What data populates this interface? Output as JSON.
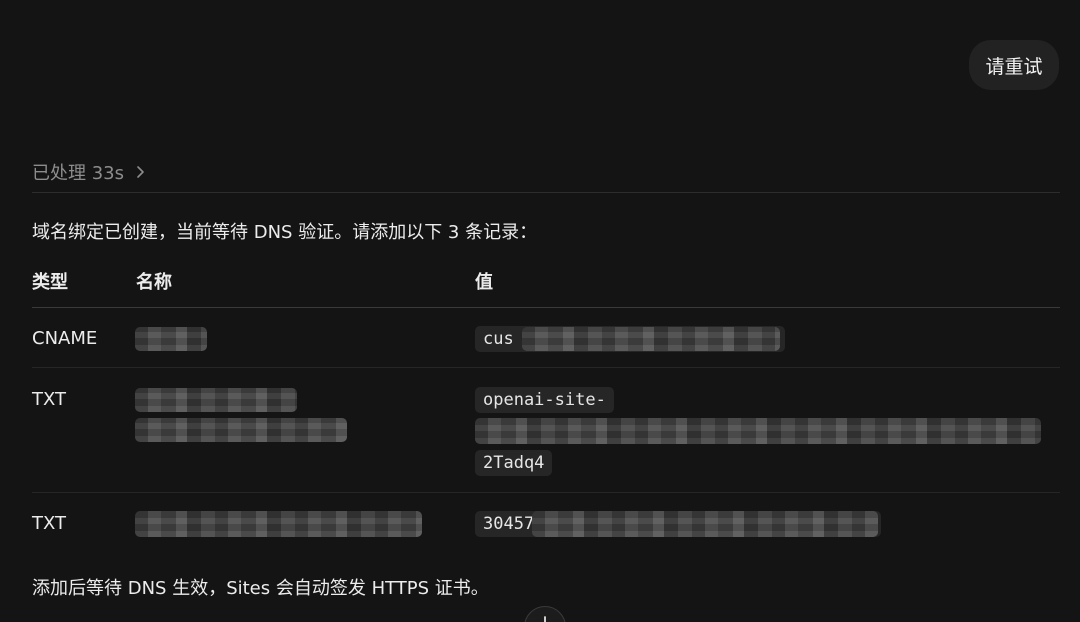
{
  "actions": {
    "retry_label": "请重试"
  },
  "status": {
    "processed_label": "已处理 33s"
  },
  "message": {
    "intro": "域名绑定已创建，当前等待 DNS 验证。请添加以下 3 条记录：",
    "footer": "添加后等待 DNS 生效，Sites 会自动签发 HTTPS 证书。"
  },
  "table": {
    "headers": [
      "类型",
      "名称",
      "值"
    ],
    "rows": [
      {
        "type": "CNAME",
        "name_visible": "",
        "value_visible": "cus"
      },
      {
        "type": "TXT",
        "name_visible": "",
        "value_lines": [
          "openai-site-",
          "",
          "2Tadq4"
        ]
      },
      {
        "type": "TXT",
        "name_visible": "",
        "value_visible": "30457"
      }
    ]
  },
  "icons": {
    "processed_chevron": "chevron-right-icon",
    "scroll_down": "arrow-down-icon"
  }
}
